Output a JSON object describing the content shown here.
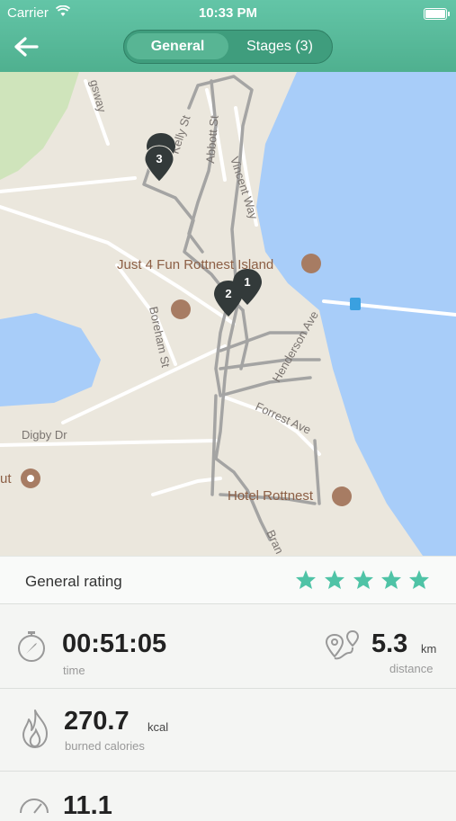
{
  "status_bar": {
    "carrier": "Carrier",
    "time": "10:33 PM"
  },
  "header": {
    "tabs": [
      {
        "label": "General",
        "active": true
      },
      {
        "label": "Stages (3)",
        "active": false
      }
    ]
  },
  "map": {
    "streets": [
      "Kelly St",
      "Abbott St",
      "Vincent Way",
      "Boreham St",
      "Henderson Ave",
      "Forrest Ave",
      "Digby Dr",
      "Bran",
      "gsway"
    ],
    "places": [
      "Just 4 Fun Rottnest Island",
      "Hotel Rottnest",
      "ut"
    ],
    "markers": [
      "1",
      "2",
      "3"
    ]
  },
  "rating": {
    "label": "General rating",
    "stars": 5,
    "max": 5
  },
  "stats": {
    "time": {
      "value": "00:51:05",
      "caption": "time"
    },
    "distance": {
      "value": "5.3",
      "unit": "km",
      "caption": "distance"
    },
    "calories": {
      "value": "270.7",
      "unit": "kcal",
      "caption": "burned calories"
    },
    "partial": {
      "value": "11.1"
    }
  },
  "colors": {
    "accent": "#4fb08f",
    "star": "#4fc3a6",
    "water": "#a8cdf9",
    "land": "#ebe7dd",
    "track": "#9b9b9b",
    "marker": "#333a3a"
  }
}
